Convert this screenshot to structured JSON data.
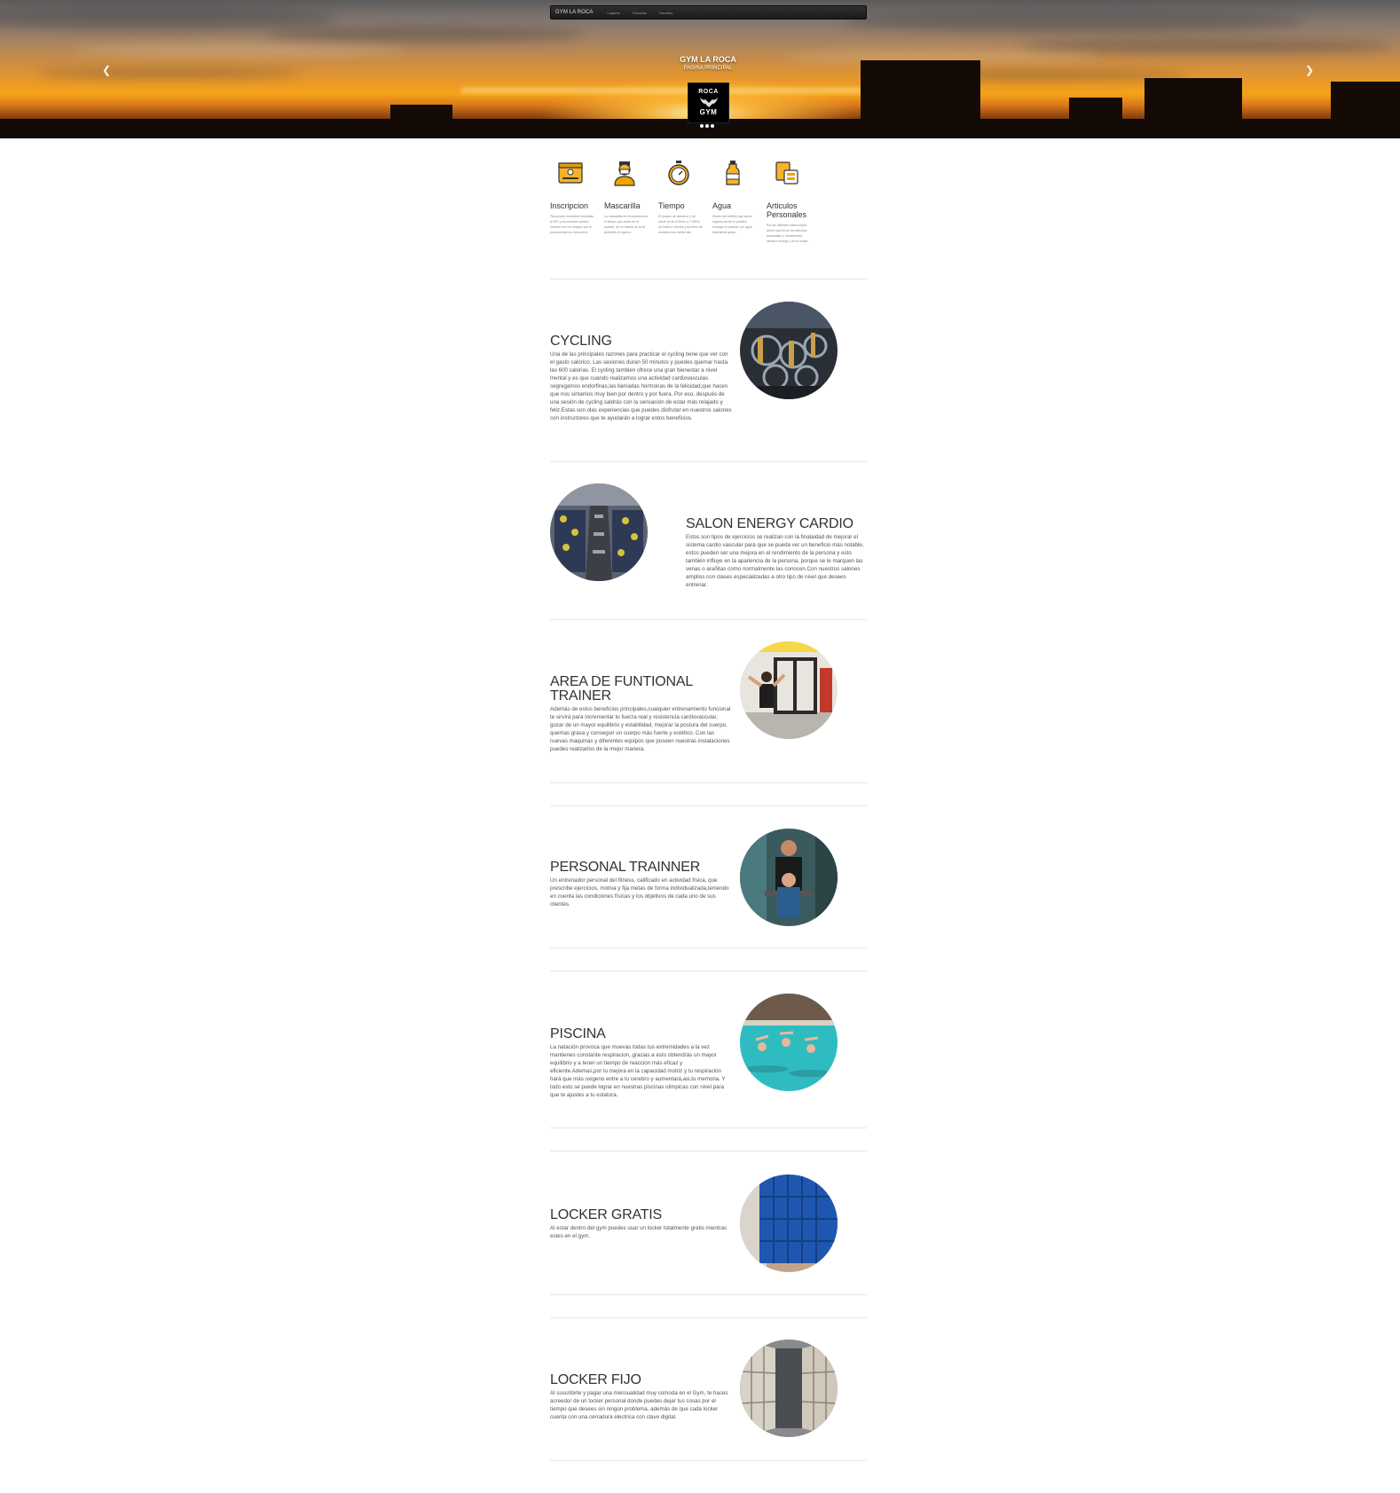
{
  "nav": {
    "brand": "GYM LA ROCA",
    "links": [
      "Lugares",
      "Servicios",
      "Horarios"
    ]
  },
  "hero": {
    "title": "GYM LA ROCA",
    "subtitle": "PAGINA PRINCIPAL",
    "logo_top": "ROCA",
    "logo_bottom": "GYM",
    "prev_icon": "chevron-left-icon",
    "next_icon": "chevron-right-icon",
    "indicators": 3
  },
  "features": [
    {
      "title": "Inscripcion",
      "icon": "id-card-icon",
      "text": "Para poder inscribirte necesitas tu DPI y encontrarte nuestro servicio con los amigos que te proporcionan un descuento."
    },
    {
      "title": "Mascarilla",
      "icon": "mask-person-icon",
      "text": "La mascarilla es necesaria todo el tiempo que estes en el estudio, de no traerla no se te permitira el ingreso."
    },
    {
      "title": "Tiempo",
      "icon": "stopwatch-icon",
      "text": "El horario de atencion y de cierre es de 8:00hrs a 7:00Pm de lunes a viernes y los fines de semana todo medio dia."
    },
    {
      "title": "Agua",
      "icon": "water-bottle-icon",
      "text": "Dentro del edificio hay varios lugares donde te pueden recargar tu pachon con agua totalmente gratis."
    },
    {
      "title": "Articulos Personales",
      "icon": "personal-items-icon",
      "text": "Por las distintas restricciones deben que llevar los articulos personales y mantenerlos siempre contigo o en tu locker."
    }
  ],
  "sections": [
    {
      "title": "CYCLING",
      "image": "cycling-photo",
      "text": "Una de las principales razones para practicar el cycling tiene que ver con el gasto calórico. Las sesiones duran 50 minutos y puedes quemar hasta las 600 calorias. El cycling tambien ofrece una gran bienestar a nivel mental y es que cuando realizamos una actividad cardiovasculas segregamos endorfinas,las llamadas hormonas de la felicidad,que hacen que nos sintamos muy bien por dentro y por fuera. Por eso, después de una sesión de cycling saldrás con la sensación de estar más relajado y feliz.Estas son olas experiencias que puedes disfrutar en nuestros salones con instructores que te ayudarán a lograr estos beneficios."
    },
    {
      "title": "SALON ENERGY CARDIO",
      "image": "cardio-room-photo",
      "text": "Estos son tipos de ejercicios se realizan con la finalaidad de mejorar el sistema cardio vascular para que se pueda ver un beneficio más notable, estos pueden ser una mejora en el rendimiento de la persona y esto también influye en la apariencia de la persona, porque se le marquen las venas o arañitas como normalmente las conocen.Con nuestros salones amplios con clases especializadas a otro tipo de nivel que desees entrenar."
    },
    {
      "title": "AREA DE FUNTIONAL TRAINER",
      "image": "functional-trainer-photo",
      "text": "Además de estos beneficios principales,cualquier entrenamiento funcional te sirvirá para incrementar tu fuerza real y resistencia cardiovascular, gozar de un mayor equilibrio y estabilidad, mejorar la postura del cuerpo, quemas grasa y conseguir un cuerpo más fuerte y estético. Con las nuevas maquinas y diferentes equipos que poseen nuestras instalaciones puedes realizarlos de la mejor manera."
    },
    {
      "title": "PERSONAL TRAINNER",
      "image": "personal-trainer-photo",
      "text": "Un entrenador personal del fitness, calificado en actividad física, que prescribe ejercicios, motiva y fija metas de forma individualizada,teniendo en cuenta las condiciones físicas y los objetivos de cada uno de sus clientes."
    },
    {
      "title": "PISCINA",
      "image": "pool-photo",
      "text": "La natación provoca que muevas todas tus extremidades a la vez mantienes constante respiracion, gracias a esto obtendrás un mayor equilibrio y a tener un tiempo de reaccion más eficaz y eficiente.Ademas,por tu mejora en la capacidad motriz y tu respiración hará que más oxigeno entre a tu cerebro y aumentará,asi,tu memoria. Y todo esto se puede lograr en nuestras piscinas olimpicas con nivel para que te ajustes a tu estatura."
    },
    {
      "title": "LOCKER GRATIS",
      "image": "blue-lockers-photo",
      "text": "Al estar dentro del gym puedes usar un locker totalmente gratis mientras estes en el gym."
    },
    {
      "title": "LOCKER FIJO",
      "image": "fixed-lockers-photo",
      "text": "Al suscribirte y pagar una mensualidad muy comoda en el Gym, te haces acreedor de un locker personal donde puedes dejar tus cosas por el tiempo que desees sin ningún problema, además de que cada locker cuenta con una cerradura electrica con clave digital."
    }
  ],
  "colors": {
    "navbar": "#222222",
    "icon_accent": "#f0a500",
    "heading": "#333333",
    "body_text": "#555555"
  }
}
